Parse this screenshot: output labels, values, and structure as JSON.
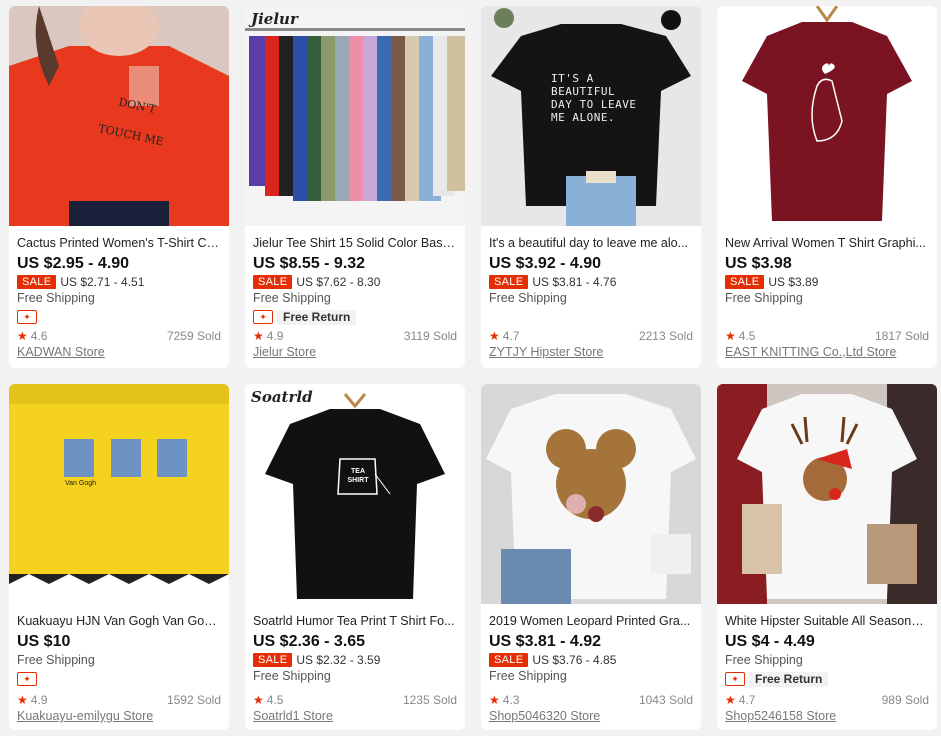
{
  "products": [
    {
      "title": "Cactus Printed Women's T-Shirt Co...",
      "price": "US $2.95 - 4.90",
      "sale_label": "SALE",
      "sale_price": "US $2.71 - 4.51",
      "shipping": "Free Shipping",
      "free_return": "",
      "rating": "4.6",
      "sold": "7259 Sold",
      "store": "KADWAN Store",
      "brand_tag": "",
      "print_text": "DON'T TOUCH ME",
      "shirt_color": "#e8391f"
    },
    {
      "title": "Jielur Tee Shirt 15 Solid Color Basic...",
      "price": "US $8.55 - 9.32",
      "sale_label": "SALE",
      "sale_price": "US $7.62 - 8.30",
      "shipping": "Free Shipping",
      "free_return": "Free Return",
      "rating": "4.9",
      "sold": "3119 Sold",
      "store": "Jielur Store",
      "brand_tag": "Jielur",
      "print_text": "",
      "shirt_color": "#cccccc"
    },
    {
      "title": "It's a beautiful day to leave me alo...",
      "price": "US $3.92 - 4.90",
      "sale_label": "SALE",
      "sale_price": "US $3.81 - 4.76",
      "shipping": "Free Shipping",
      "free_return": "",
      "rating": "4.7",
      "sold": "2213 Sold",
      "store": "ZYTJY Hipster Store",
      "brand_tag": "",
      "print_text": "IT'S A BEAUTIFUL DAY TO LEAVE ME ALONE.",
      "shirt_color": "#111111"
    },
    {
      "title": "New Arrival Women T Shirt Graphi...",
      "price": "US $3.98",
      "sale_label": "SALE",
      "sale_price": "US $3.89",
      "shipping": "Free Shipping",
      "free_return": "",
      "rating": "4.5",
      "sold": "1817 Sold",
      "store": "EAST KNITTING Co.,Ltd Store",
      "brand_tag": "",
      "print_text": "",
      "shirt_color": "#7a1422"
    },
    {
      "title": "Kuakuayu HJN Van Gogh Van Gogh...",
      "price": "US $10",
      "sale_label": "",
      "sale_price": "",
      "shipping": "Free Shipping",
      "free_return": "",
      "rating": "4.9",
      "sold": "1592 Sold",
      "store": "Kuakuayu-emilygu Store",
      "brand_tag": "",
      "print_text": "Van Gogh",
      "shirt_color": "#f5d21e"
    },
    {
      "title": "Soatrld Humor Tea Print T Shirt Fo...",
      "price": "US $2.36 - 3.65",
      "sale_label": "SALE",
      "sale_price": "US $2.32 - 3.59",
      "shipping": "Free Shipping",
      "free_return": "",
      "rating": "4.5",
      "sold": "1235 Sold",
      "store": "Soatrld1 Store",
      "brand_tag": "Soatrld",
      "print_text": "TEA SHIRT",
      "shirt_color": "#111111"
    },
    {
      "title": "2019 Women Leopard Printed Gra...",
      "price": "US $3.81 - 4.92",
      "sale_label": "SALE",
      "sale_price": "US $3.76 - 4.85",
      "shipping": "Free Shipping",
      "free_return": "",
      "rating": "4.3",
      "sold": "1043 Sold",
      "store": "Shop5046320 Store",
      "brand_tag": "",
      "print_text": "",
      "shirt_color": "#f7f7f7"
    },
    {
      "title": "White Hipster Suitable All Seasons ...",
      "price": "US $4 - 4.49",
      "sale_label": "",
      "sale_price": "",
      "shipping": "Free Shipping",
      "free_return": "Free Return",
      "rating": "4.7",
      "sold": "989 Sold",
      "store": "Shop5246158 Store",
      "brand_tag": "",
      "print_text": "",
      "shirt_color": "#f7f7f7"
    }
  ],
  "colors": {
    "accent": "#e62e04",
    "background": "#f2f2f2"
  },
  "icons": {
    "star": "star-icon",
    "coupon": "coupon-icon"
  }
}
